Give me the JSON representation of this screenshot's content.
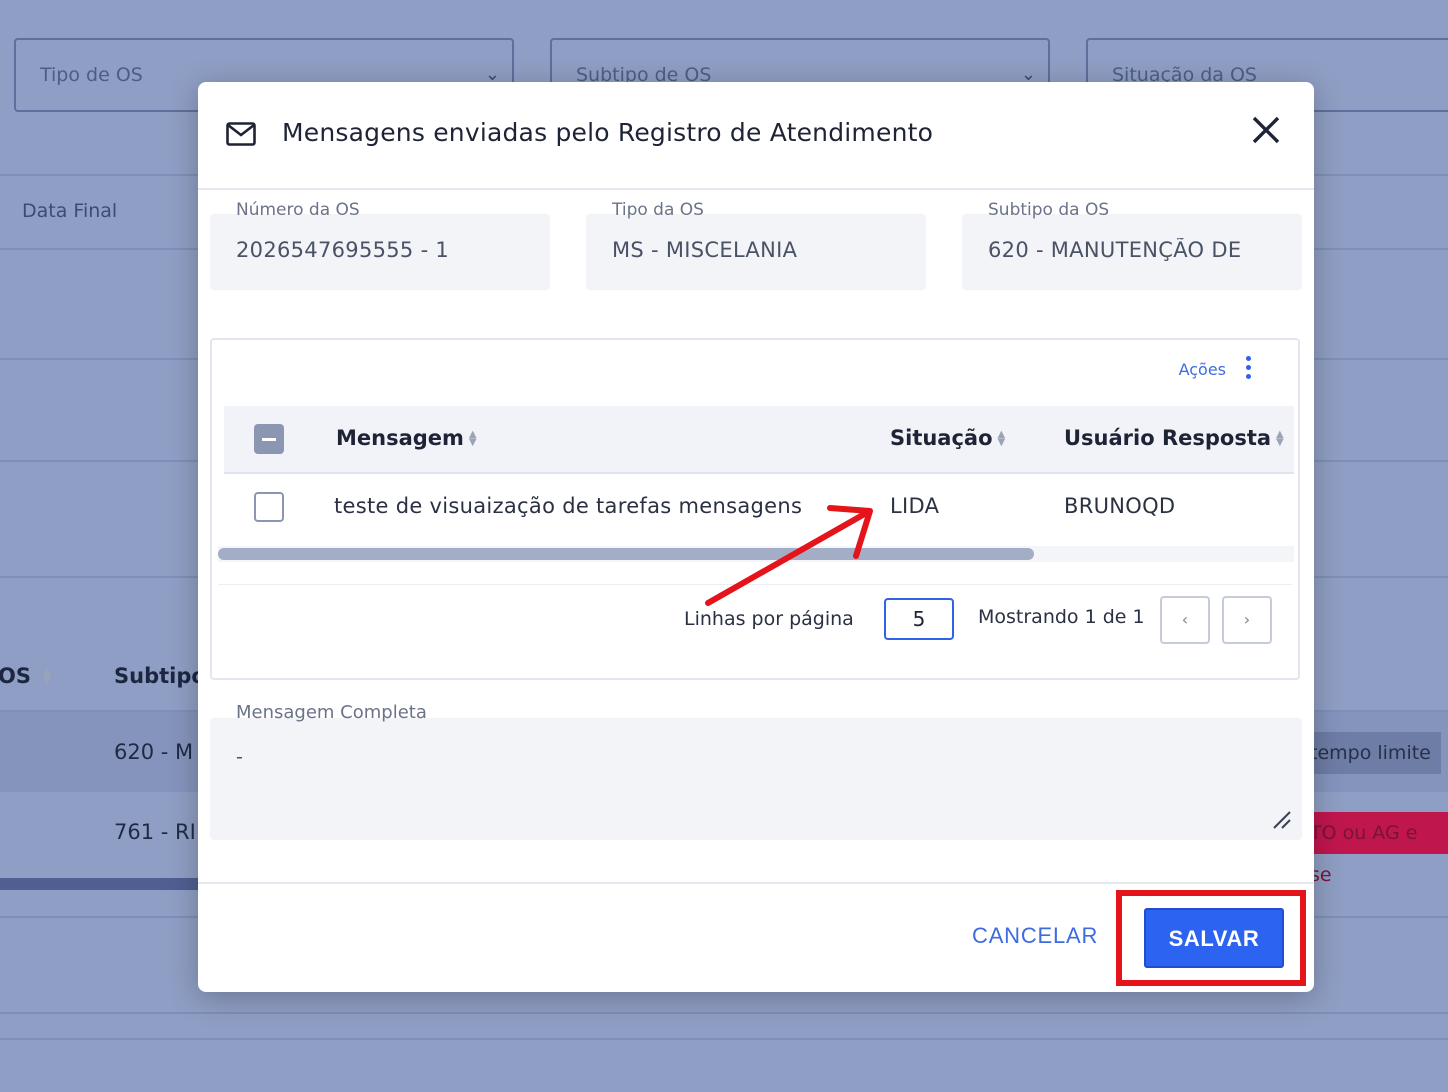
{
  "background": {
    "filters": {
      "tipo_os": "Tipo de OS",
      "subtipo_os": "Subtipo de OS",
      "situacao_os": "Situação da OS"
    },
    "data_final_label": "Data Final",
    "table_col_os": "OS",
    "table_col_subtipo": "Subtipo",
    "rows": [
      {
        "subtipo": "620 - M",
        "badge": "tempo limite"
      },
      {
        "subtipo": "761 - RI",
        "badge": "TO ou AG e se"
      }
    ],
    "colors": {
      "overlay": "#8f9ec4",
      "badge_red": "#c0164e"
    }
  },
  "modal": {
    "title": "Mensagens enviadas pelo Registro de Atendimento",
    "icon": "mail-icon",
    "close_icon": "close-icon",
    "fields": {
      "numero_os": {
        "label": "Número da OS",
        "value": "2026547695555 - 1"
      },
      "tipo_os": {
        "label": "Tipo da OS",
        "value": "MS - MISCELANIA"
      },
      "subtipo_os": {
        "label": "Subtipo da OS",
        "value": "620 -  MANUTENÇÃO DE"
      }
    },
    "table": {
      "acoes_label": "Ações",
      "columns": [
        "Mensagem",
        "Situação",
        "Usuário Resposta"
      ],
      "rows": [
        {
          "mensagem": "teste de visuaização de tarefas mensagens",
          "situacao": "LIDA",
          "usuario": "BRUNOQD"
        }
      ],
      "pagination": {
        "rows_per_page_label": "Linhas por página",
        "rows_per_page": "5",
        "info": "Mostrando 1 de 1",
        "prev": "‹",
        "next": "›"
      }
    },
    "mensagem_completa": {
      "label": "Mensagem Completa",
      "value": "-"
    },
    "buttons": {
      "cancel": "CANCELAR",
      "save": "SALVAR"
    },
    "colors": {
      "primary": "#2c63f0",
      "annotation": "#e5141b"
    }
  }
}
